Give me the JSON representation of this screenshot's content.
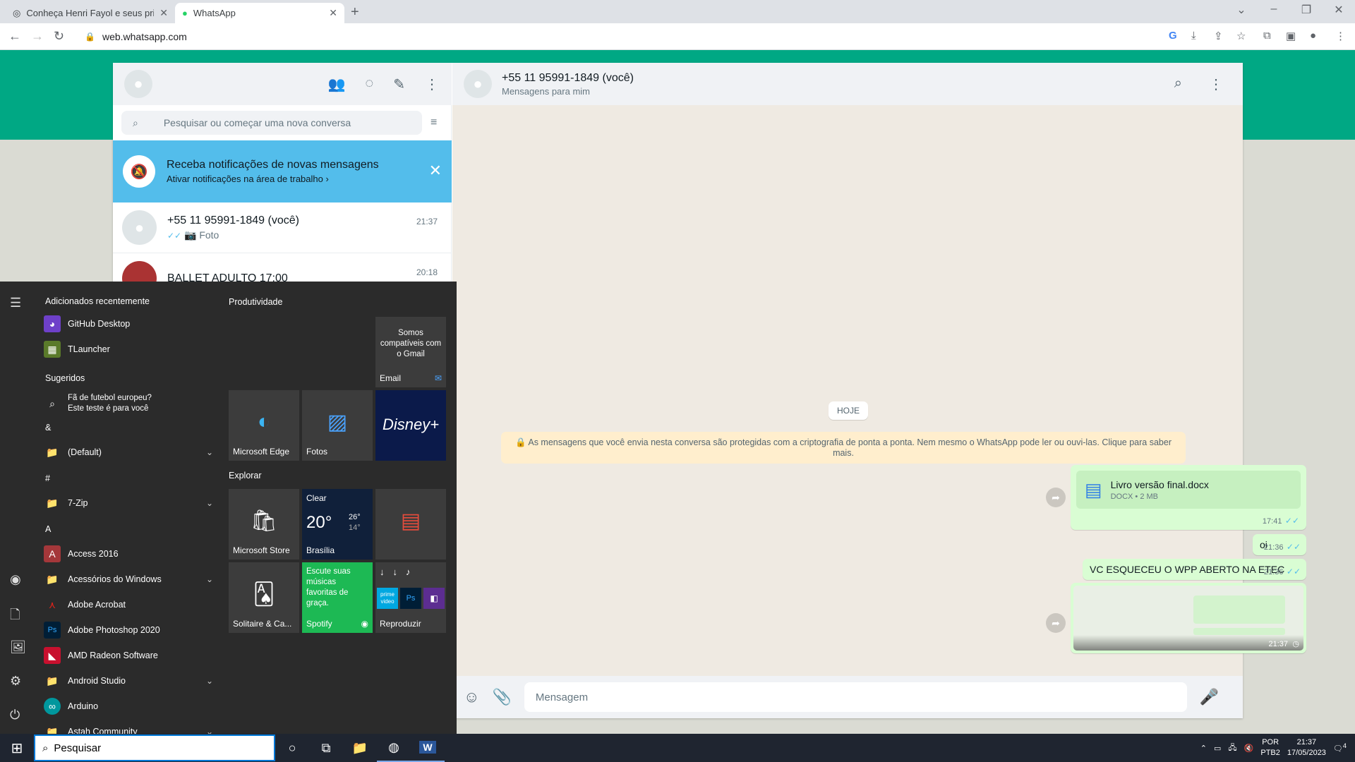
{
  "browser": {
    "tabs": [
      {
        "title": "Conheça Henri Fayol e seus princ"
      },
      {
        "title": "WhatsApp"
      }
    ],
    "url": "web.whatsapp.com"
  },
  "sidebar": {
    "search_placeholder": "Pesquisar ou começar uma nova conversa",
    "notification": {
      "title": "Receba notificações de novas mensagens",
      "subtitle": "Ativar notificações na área de trabalho ›"
    },
    "chats": [
      {
        "name": "+55 11 95991-1849 (você)",
        "preview": "Foto",
        "time": "21:37"
      },
      {
        "name": "BALLET ADULTO 17:00",
        "preview": "",
        "time": "20:18"
      }
    ]
  },
  "conversation": {
    "name": "+55 11 95991-1849 (você)",
    "subtitle": "Mensagens para mim",
    "day": "HOJE",
    "e2e": "As mensagens que você envia nesta conversa são protegidas com a criptografia de ponta a ponta. Nem mesmo o WhatsApp pode ler ou ouvi-las. Clique para saber mais.",
    "messages": [
      {
        "type": "document",
        "filename": "Livro versão final.docx",
        "meta": "DOCX • 2 MB",
        "time": "17:41"
      },
      {
        "type": "text",
        "text": "oi",
        "time": "21:36"
      },
      {
        "type": "text",
        "text": "VC ESQUECEU O WPP ABERTO NA ETEC",
        "time": "21:36"
      },
      {
        "type": "image",
        "time": "21:37"
      }
    ],
    "composer_placeholder": "Mensagem"
  },
  "startmenu": {
    "recent_header": "Adicionados recentemente",
    "recent": [
      "GitHub Desktop",
      "TLauncher"
    ],
    "suggested_header": "Sugeridos",
    "suggested": {
      "line1": "Fã de futebol europeu?",
      "line2": "Este teste é para você"
    },
    "letters": [
      "&",
      "#",
      "A"
    ],
    "apps": [
      "(Default)",
      "7-Zip",
      "Access 2016",
      "Acessórios do Windows",
      "Adobe Acrobat",
      "Adobe Photoshop 2020",
      "AMD Radeon Software",
      "Android Studio",
      "Arduino",
      "Astah Community"
    ],
    "productivity_header": "Produtividade",
    "explore_header": "Explorar",
    "tiles": {
      "gmail_text": "Somos compatíveis com o Gmail",
      "email": "Email",
      "edge": "Microsoft Edge",
      "photos": "Fotos",
      "store": "Microsoft Store",
      "weather_cond": "Clear",
      "weather_temp": "20°",
      "weather_hi": "26°",
      "weather_lo": "14°",
      "weather_city": "Brasília",
      "solitaire": "Solitaire & Ca...",
      "spotify_text": "Escute suas músicas favoritas de graça.",
      "spotify": "Spotify",
      "play": "Reproduzir",
      "prime": "prime video",
      "ps": "Ps"
    }
  },
  "taskbar": {
    "search": "Pesquisar",
    "lang1": "POR",
    "lang2": "PTB2",
    "time": "21:37",
    "date": "17/05/2023",
    "notif_count": "4"
  }
}
